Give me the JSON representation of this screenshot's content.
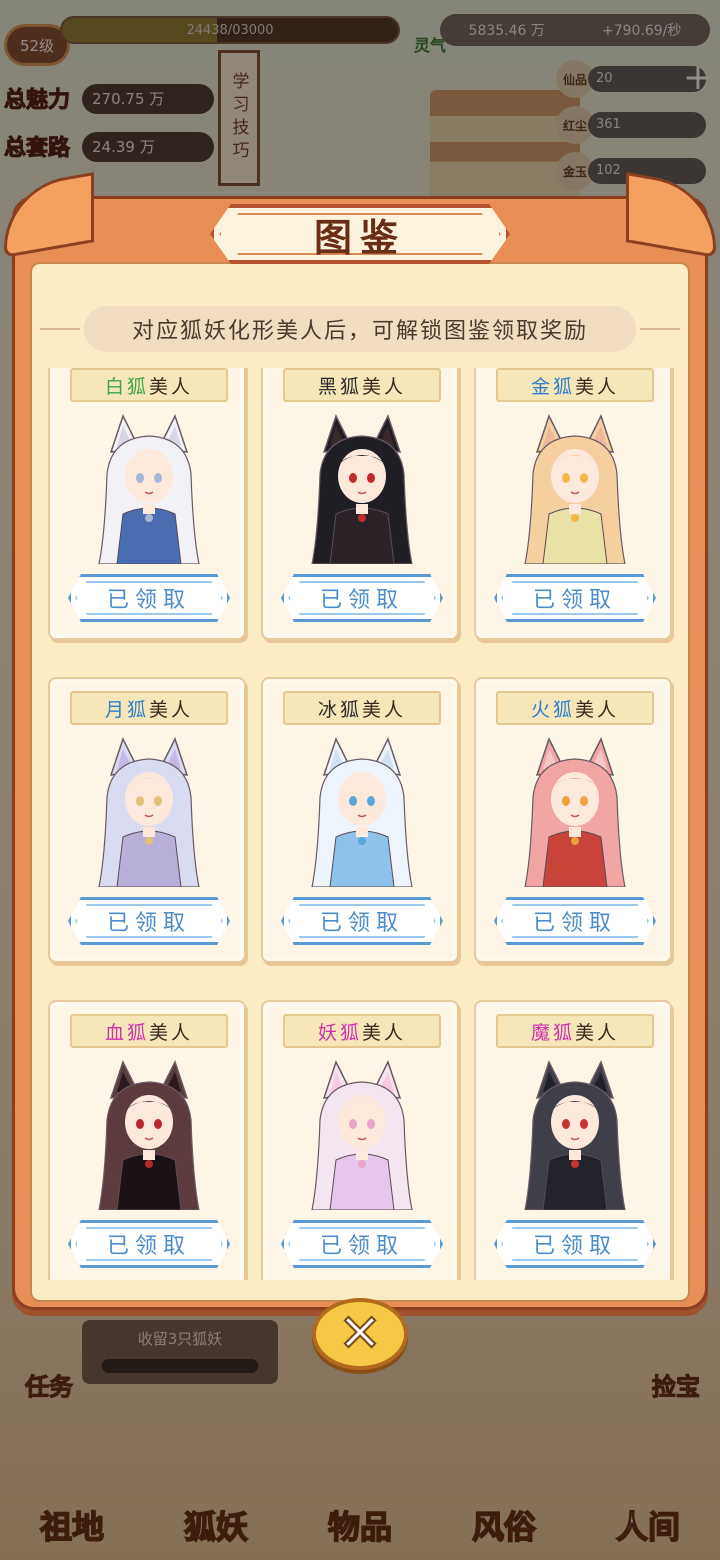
{
  "hud": {
    "level": "52级",
    "xp_text": "24438/03000",
    "stats": [
      {
        "label": "总魅力",
        "value": "270.75 万"
      },
      {
        "label": "总套路",
        "value": "24.39 万"
      }
    ],
    "learn_skills": "学习技巧",
    "aura": {
      "label": "灵气",
      "value": "5835.46 万",
      "rate": "+790.69/秒"
    },
    "resources": [
      {
        "label": "仙品",
        "value": "20"
      },
      {
        "label": "红尘",
        "value": "361"
      },
      {
        "label": "金玉",
        "value": "102"
      }
    ],
    "plus": "+",
    "task": "任务",
    "collect_text": "收留3只狐妖",
    "lost_treasure": "捡宝",
    "nav": [
      "祖地",
      "狐妖",
      "物品",
      "风俗",
      "人间"
    ]
  },
  "modal": {
    "title": "图鉴",
    "hint": "对应狐妖化形美人后，可解锁图鉴领取奖励",
    "cards": [
      {
        "type": "白狐",
        "suffix": "美人",
        "type_color": "#3aa84a",
        "button": "已领取",
        "portrait": "white-fox-beauty"
      },
      {
        "type": "黑狐",
        "suffix": "美人",
        "type_color": "#2a2a2a",
        "button": "已领取",
        "portrait": "black-fox-beauty"
      },
      {
        "type": "金狐",
        "suffix": "美人",
        "type_color": "#2f7fd0",
        "button": "已领取",
        "portrait": "golden-fox-beauty"
      },
      {
        "type": "月狐",
        "suffix": "美人",
        "type_color": "#2f7fd0",
        "button": "已领取",
        "portrait": "moon-fox-beauty"
      },
      {
        "type": "冰狐",
        "suffix": "美人",
        "type_color": "#2a2a2a",
        "button": "已领取",
        "portrait": "ice-fox-beauty"
      },
      {
        "type": "火狐",
        "suffix": "美人",
        "type_color": "#2f7fd0",
        "button": "已领取",
        "portrait": "fire-fox-beauty"
      },
      {
        "type": "血狐",
        "suffix": "美人",
        "type_color": "#d02fb0",
        "button": "已领取",
        "portrait": "blood-fox-beauty"
      },
      {
        "type": "妖狐",
        "suffix": "美人",
        "type_color": "#d02fb0",
        "button": "已领取",
        "portrait": "demon-fox-beauty"
      },
      {
        "type": "魔狐",
        "suffix": "美人",
        "type_color": "#d02fb0",
        "button": "已领取",
        "portrait": "devil-fox-beauty"
      }
    ],
    "close_icon": "close-icon"
  },
  "palette": {
    "modal_orange": "#e88f57",
    "panel_cream": "#fbecc4",
    "claim_blue": "#4b8cc9"
  }
}
